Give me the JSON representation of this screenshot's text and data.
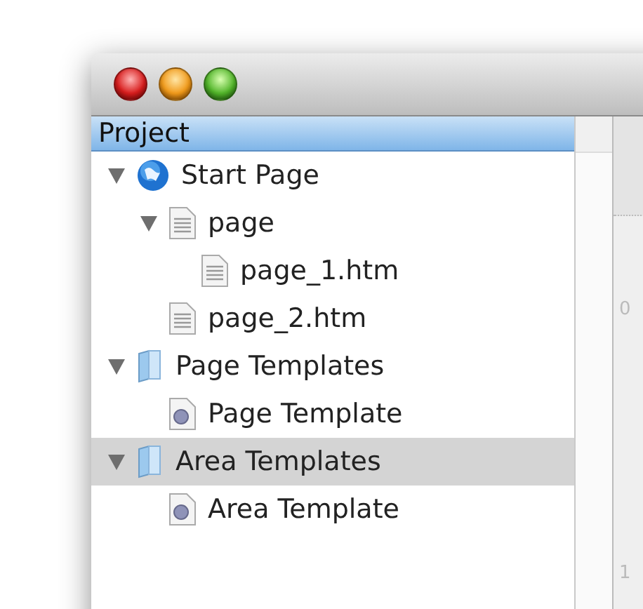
{
  "panel": {
    "title": "Project"
  },
  "tree": [
    {
      "label": "Start Page",
      "kind": "site",
      "expanded": true,
      "selected": false,
      "children": [
        {
          "label": "page",
          "kind": "page",
          "expanded": true,
          "selected": false,
          "children": [
            {
              "label": "page_1.htm",
              "kind": "page",
              "selected": false
            }
          ]
        },
        {
          "label": "page_2.htm",
          "kind": "page",
          "selected": false
        }
      ]
    },
    {
      "label": "Page Templates",
      "kind": "folder",
      "expanded": true,
      "selected": false,
      "children": [
        {
          "label": "Page Template",
          "kind": "template",
          "selected": false
        }
      ]
    },
    {
      "label": "Area Templates",
      "kind": "folder",
      "expanded": true,
      "selected": true,
      "children": [
        {
          "label": "Area Template",
          "kind": "template",
          "selected": false
        }
      ]
    }
  ],
  "side_panel": {
    "line_numbers": [
      "0",
      "1"
    ]
  }
}
